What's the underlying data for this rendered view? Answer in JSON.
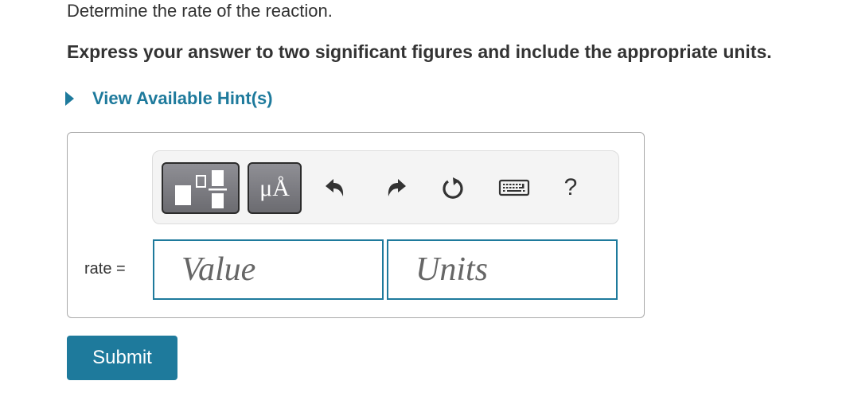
{
  "question": {
    "instruction": "Determine the rate of the reaction.",
    "instruction_bold": "Express your answer to two significant figures and include the appropriate units."
  },
  "hints": {
    "label": "View Available Hint(s)",
    "expanded": false
  },
  "toolbar": {
    "templates_icon": "fraction-exponent-templates-icon",
    "units_label": "μÅ",
    "undo_icon": "undo-icon",
    "redo_icon": "redo-icon",
    "reset_icon": "reset-icon",
    "keyboard_icon": "keyboard-icon",
    "help_label": "?"
  },
  "answer": {
    "label": "rate =",
    "value_placeholder": "Value",
    "units_placeholder": "Units",
    "value": "",
    "units": ""
  },
  "submit": {
    "label": "Submit"
  },
  "colors": {
    "accent": "#1e7a9c",
    "text": "#333333",
    "placeholder": "#666666",
    "toolbar_bg": "#f4f4f4"
  }
}
